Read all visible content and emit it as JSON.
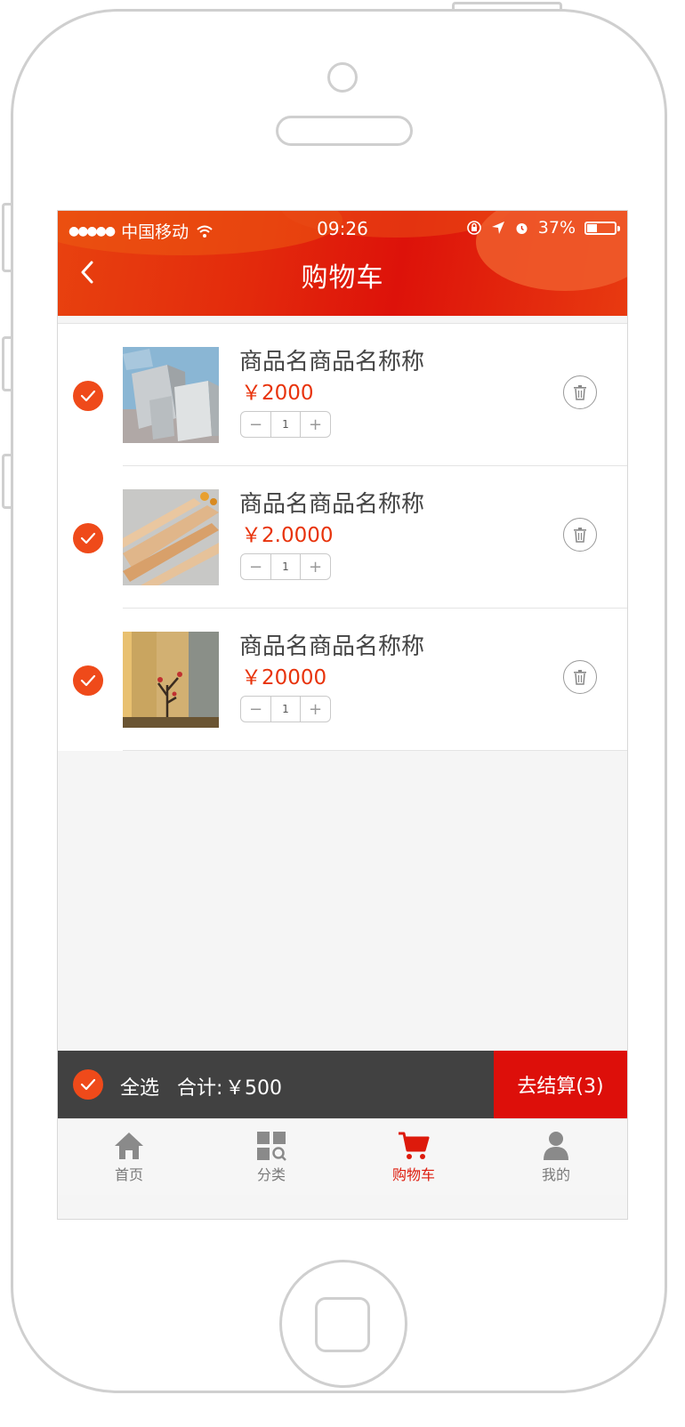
{
  "statusbar": {
    "carrier": "中国移动",
    "signal_dots": "●●●●●",
    "time": "09:26",
    "battery": "37%",
    "battery_level": 0.37
  },
  "header": {
    "title": "购物车"
  },
  "cart": {
    "items": [
      {
        "name": "商品名商品名称称",
        "price": "￥2000",
        "quantity": "1",
        "checked": true
      },
      {
        "name": "商品名商品名称称",
        "price": "￥2.0000",
        "quantity": "1",
        "checked": true
      },
      {
        "name": "商品名商品名称称",
        "price": "￥20000",
        "quantity": "1",
        "checked": true
      }
    ]
  },
  "bottom_bar": {
    "select_all": "全选",
    "total_label": "合计:",
    "total_value": "￥500",
    "checkout": "去结算(3)"
  },
  "tabbar": {
    "items": [
      {
        "label": "首页",
        "icon": "home-icon",
        "active": false
      },
      {
        "label": "分类",
        "icon": "category-icon",
        "active": false
      },
      {
        "label": "购物车",
        "icon": "cart-icon",
        "active": true
      },
      {
        "label": "我的",
        "icon": "user-icon",
        "active": false
      }
    ]
  },
  "colors": {
    "accent": "#ef4a1a",
    "header_red": "#dd120a",
    "price": "#e8330b",
    "bar_dark": "#414141"
  }
}
